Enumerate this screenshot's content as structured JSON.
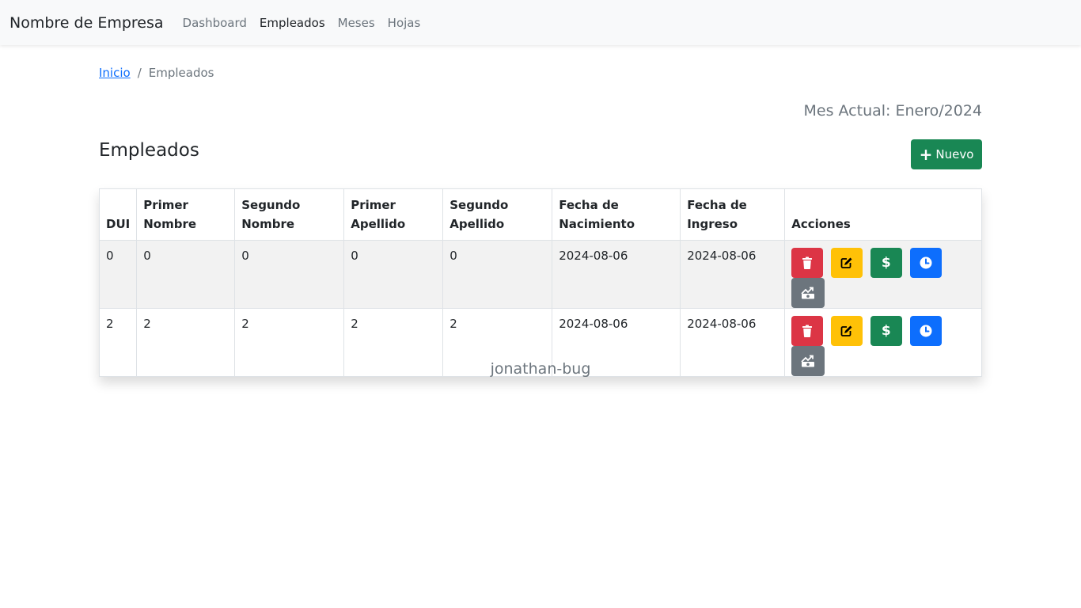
{
  "navbar": {
    "brand": "Nombre de Empresa",
    "links": [
      {
        "label": "Dashboard",
        "active": false
      },
      {
        "label": "Empleados",
        "active": true
      },
      {
        "label": "Meses",
        "active": false
      },
      {
        "label": "Hojas",
        "active": false
      }
    ]
  },
  "breadcrumb": {
    "home": "Inicio",
    "separator": "/",
    "current": "Empleados"
  },
  "month_label": "Mes Actual: Enero/2024",
  "page_title": "Empleados",
  "new_button": {
    "icon": "+",
    "label": "Nuevo"
  },
  "table": {
    "headers": [
      [
        "DUI"
      ],
      [
        "Primer",
        "Nombre"
      ],
      [
        "Segundo",
        "Nombre"
      ],
      [
        "Primer",
        "Apellido"
      ],
      [
        "Segundo",
        "Apellido"
      ],
      [
        "Fecha de",
        "Nacimiento"
      ],
      [
        "Fecha de",
        "Ingreso"
      ],
      [
        "Acciones"
      ]
    ],
    "rows": [
      [
        "0",
        "0",
        "0",
        "0",
        "0",
        "2024-08-06",
        "2024-08-06"
      ],
      [
        "2",
        "2",
        "2",
        "2",
        "2",
        "2024-08-06",
        "2024-08-06"
      ]
    ],
    "actions": [
      {
        "name": "delete",
        "icon": "trash-icon",
        "color": "#dc3545"
      },
      {
        "name": "edit",
        "icon": "edit-icon",
        "color": "#ffc107"
      },
      {
        "name": "salary",
        "icon": "dollar-icon",
        "color": "#198754",
        "glyph": "$"
      },
      {
        "name": "hours",
        "icon": "clock-icon",
        "color": "#0d6efd"
      },
      {
        "name": "payroll",
        "icon": "money-chart-icon",
        "color": "#6c757d"
      }
    ]
  },
  "footer": "jonathan-bug",
  "colors": {
    "navbar_bg": "#f8f9fa",
    "primary": "#0d6efd",
    "success": "#198754",
    "danger": "#dc3545",
    "warning": "#ffc107",
    "secondary": "#6c757d"
  }
}
